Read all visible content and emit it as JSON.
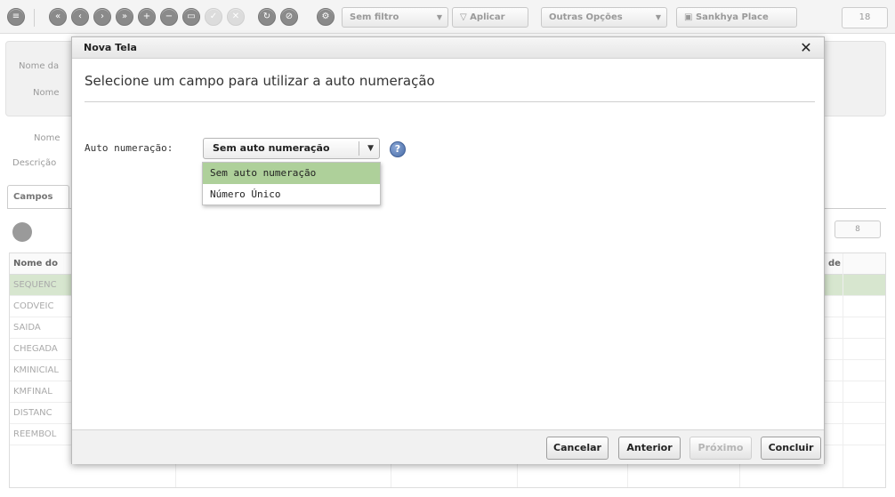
{
  "toolbar": {
    "filter_label": "Sem filtro",
    "apply_label": "Aplicar",
    "more_options_label": "Outras Opções",
    "place_label": "Sankhya Place",
    "page_count": "18"
  },
  "background": {
    "form_labels": [
      "Nome da",
      "Nome",
      "Nome",
      "Descrição"
    ],
    "tab_label": "Campos",
    "grid_header": "Nome do",
    "grid_header_right": "de",
    "grid_rows": [
      "SEQUENC",
      "CODVEIC",
      "SAIDA",
      "CHEGADA",
      "KMINICIAL",
      "KMFINAL",
      "DISTANC",
      "REEMBOL"
    ],
    "grid_page_count": "8"
  },
  "modal": {
    "title": "Nova Tela",
    "close_glyph": "✕",
    "heading": "Selecione um campo para utilizar a auto numeração",
    "field_label": "Auto numeração:",
    "combo_value": "Sem auto numeração",
    "combo_arrow": "▼",
    "help_glyph": "?",
    "options": [
      {
        "label": "Sem auto numeração",
        "selected": true
      },
      {
        "label": "Número Único",
        "selected": false
      }
    ],
    "buttons": {
      "cancel": "Cancelar",
      "previous": "Anterior",
      "next": "Próximo",
      "finish": "Concluir"
    }
  },
  "colors": {
    "selected_option": "#aed09a",
    "selected_row": "#d7e6cf",
    "help_icon": "#4a6ea8"
  }
}
